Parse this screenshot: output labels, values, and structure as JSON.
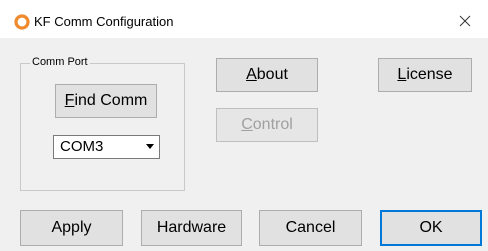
{
  "window": {
    "title": "KF Comm Configuration",
    "close_glyph": "×",
    "icon": "orange-ring-icon",
    "icon_color": "#f08a2c"
  },
  "comm_port_group": {
    "label": "Comm Port",
    "find_comm": {
      "mnemonic": "F",
      "rest": "ind Comm"
    },
    "port_select": {
      "value": "COM3",
      "options_visible": [
        "COM3"
      ]
    }
  },
  "buttons": {
    "about": {
      "mnemonic": "A",
      "rest": "bout"
    },
    "control": {
      "mnemonic": "C",
      "rest": "ontrol",
      "enabled": false
    },
    "license": {
      "mnemonic": "L",
      "rest": "icense"
    },
    "apply": {
      "label": "Apply"
    },
    "hardware": {
      "label": "Hardware"
    },
    "cancel": {
      "label": "Cancel"
    },
    "ok": {
      "label": "OK",
      "is_default": true
    }
  },
  "colors": {
    "default_button_border": "#0078d7",
    "disabled_text": "#a0a0a0",
    "dialog_background": "#f0f0f0"
  }
}
